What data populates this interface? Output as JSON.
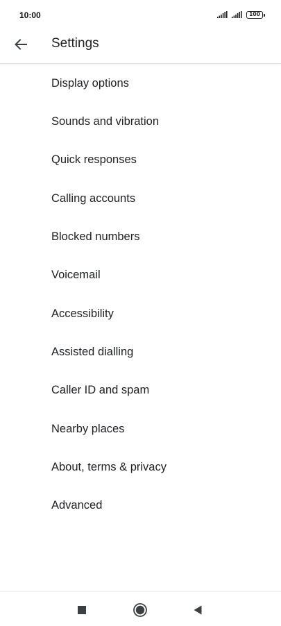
{
  "status_bar": {
    "time": "10:00",
    "battery_level": "100",
    "icons": [
      "signal-icon",
      "signal-icon",
      "battery-icon"
    ]
  },
  "app_bar": {
    "title": "Settings",
    "back_icon": "arrow-back-icon"
  },
  "settings": {
    "items": [
      {
        "label": "Display options"
      },
      {
        "label": "Sounds and vibration"
      },
      {
        "label": "Quick responses"
      },
      {
        "label": "Calling accounts"
      },
      {
        "label": "Blocked numbers"
      },
      {
        "label": "Voicemail"
      },
      {
        "label": "Accessibility"
      },
      {
        "label": "Assisted dialling"
      },
      {
        "label": "Caller ID and spam"
      },
      {
        "label": "Nearby places"
      },
      {
        "label": "About, terms & privacy"
      },
      {
        "label": "Advanced"
      }
    ]
  },
  "nav_bar": {
    "icons": [
      "recents-square-icon",
      "home-circle-icon",
      "back-triangle-icon"
    ]
  },
  "colors": {
    "text": "#202124",
    "background": "#ffffff",
    "divider": "#e4e4e4"
  }
}
